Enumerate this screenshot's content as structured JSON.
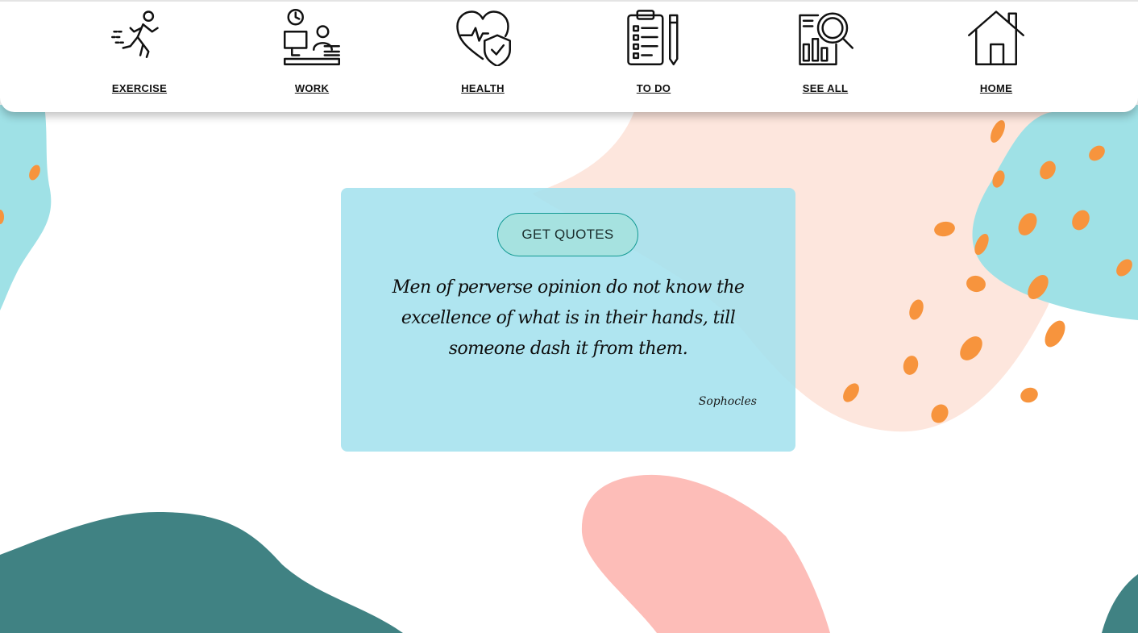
{
  "nav": {
    "items": [
      {
        "label": "EXERCISE",
        "icon": "running-person-icon"
      },
      {
        "label": "WORK",
        "icon": "office-desk-clock-icon"
      },
      {
        "label": "HEALTH",
        "icon": "heart-shield-icon"
      },
      {
        "label": "TO DO",
        "icon": "clipboard-checklist-icon"
      },
      {
        "label": "SEE ALL",
        "icon": "report-magnifier-icon"
      },
      {
        "label": "HOME",
        "icon": "house-icon"
      }
    ]
  },
  "quote": {
    "button_label": "GET QUOTES",
    "text": "Men of perverse opinion do not know the excellence of what is in their hands, till someone dash it from them.",
    "author": "Sophocles"
  },
  "colors": {
    "card_background": "#a4e1ee",
    "button_border": "#139a93",
    "blob_cyan": "#9fe1e6",
    "blob_peach": "#fde6dd",
    "blob_pink": "#fdbdb8",
    "blob_teal": "#408283",
    "dots_orange": "#f7943d"
  }
}
